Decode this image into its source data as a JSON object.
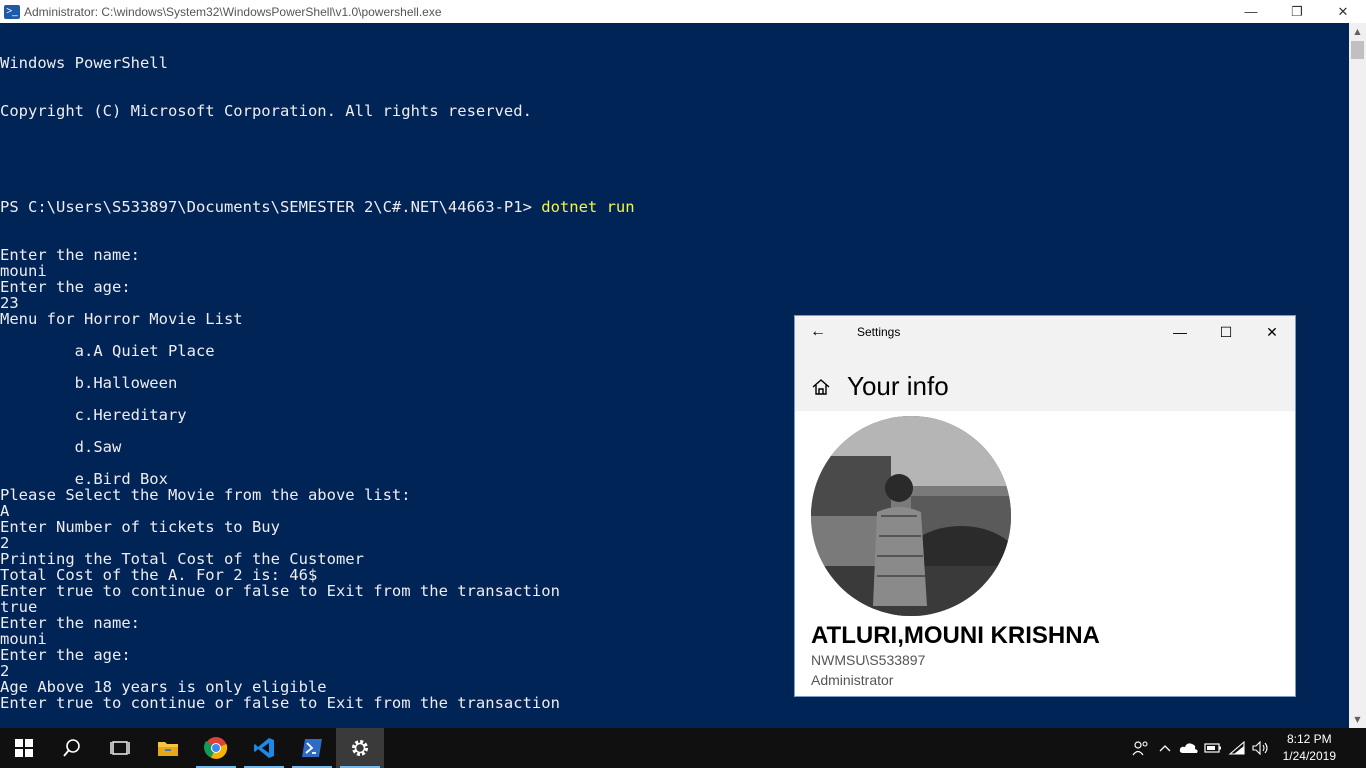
{
  "powershell": {
    "title": "Administrator: C:\\windows\\System32\\WindowsPowerShell\\v1.0\\powershell.exe",
    "minimize_glyph": "—",
    "restore_glyph": "❐",
    "close_glyph": "✕",
    "header_lines": [
      "Windows PowerShell",
      "Copyright (C) Microsoft Corporation. All rights reserved.",
      ""
    ],
    "prompt": "PS C:\\Users\\S533897\\Documents\\SEMESTER 2\\C#.NET\\44663-P1> ",
    "command": "dotnet run",
    "output_lines": [
      "Enter the name:",
      "mouni",
      "Enter the age:",
      "23",
      "Menu for Horror Movie List",
      "",
      "        a.A Quiet Place",
      "",
      "        b.Halloween",
      "",
      "        c.Hereditary",
      "",
      "        d.Saw",
      "",
      "        e.Bird Box",
      "Please Select the Movie from the above list:",
      "A",
      "Enter Number of tickets to Buy",
      "2",
      "Printing the Total Cost of the Customer",
      "Total Cost of the A. For 2 is: 46$",
      "Enter true to continue or false to Exit from the transaction",
      "true",
      "Enter the name:",
      "mouni",
      "Enter the age:",
      "2",
      "Age Above 18 years is only eligible",
      "Enter true to continue or false to Exit from the transaction"
    ]
  },
  "settings": {
    "window_title": "Settings",
    "back_glyph": "←",
    "minimize_glyph": "—",
    "maximize_glyph": "☐",
    "close_glyph": "✕",
    "page_title": "Your info",
    "user_name": "ATLURI,MOUNI KRISHNA",
    "account": "NWMSU\\S533897",
    "role": "Administrator"
  },
  "taskbar": {
    "items": [
      "start-icon",
      "search-icon",
      "task-view-icon",
      "file-explorer-icon",
      "chrome-icon",
      "vscode-icon",
      "powershell-icon",
      "settings-icon"
    ],
    "tray_icons": [
      "people-icon",
      "chevron-up-icon",
      "onedrive-icon",
      "battery-icon",
      "wifi-icon",
      "volume-icon"
    ],
    "time": "8:12 PM",
    "date": "1/24/2019"
  }
}
